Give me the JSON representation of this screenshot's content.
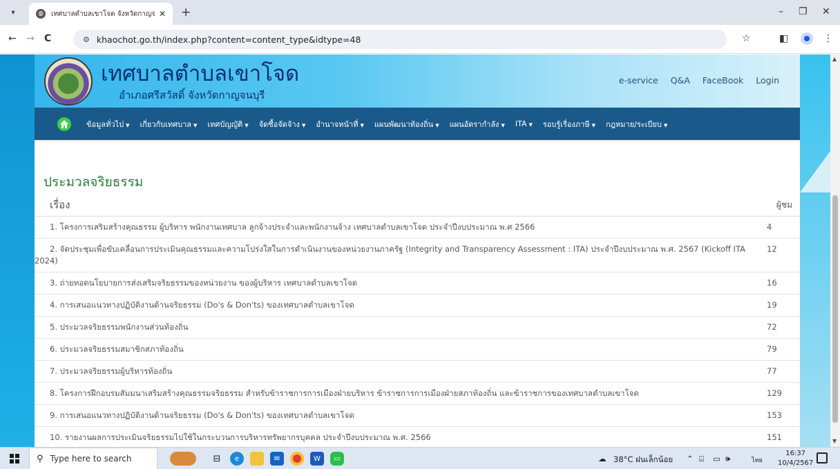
{
  "browser": {
    "tab_title": "เทศบาลตำบลเขาโจด จังหวัดกาญจนบุรี",
    "tab_close": "✕",
    "new_tab": "+",
    "url": "khaochot.go.th/index.php?content=content_type&idtype=48",
    "controls": {
      "minimize": "–",
      "maximize": "❐",
      "close": "✕",
      "back": "←",
      "forward": "→",
      "reload": "C",
      "star": "☆",
      "menu": "⋮"
    }
  },
  "site": {
    "title": "เทศบาลตำบลเขาโจด",
    "subtitle": "อำเภอศรีสวัสดิ์  จังหวัดกาญจนบุรี",
    "header_links": [
      "e-service",
      "Q&A",
      "FaceBook",
      "Login"
    ]
  },
  "nav": {
    "items": [
      "ข้อมูลทั่วไป",
      "เกี่ยวกับเทศบาล",
      "เทศบัญญัติ",
      "จัดซื้อจัดจ้าง",
      "อำนาจหน้าที่",
      "แผนพัฒนาท้องถิ่น",
      "แผนอัตรากำลัง",
      "ITA",
      "รอบรู้เรื่องภาษี",
      "กฎหมาย/ระเบียบ"
    ]
  },
  "section": {
    "title": "ประมวลจริยธรรม",
    "col_title": "เรื่อง",
    "col_views": "ผู้ชม"
  },
  "rows": [
    {
      "title": "1. โครงการเสริมสร้างคุณธรรม ผู้บริหาร พนักงานเทศบาล ลูกจ้างประจำและพนักงานจ้าง เทศบาลตำบลเขาโจด ประจำปีงบประมาณ พ.ศ 2566",
      "views": "4"
    },
    {
      "title": "2. จัดประชุมเพื่อขับเคลื่อนการประเมินคุณธรรมและความโปร่งใสในการดำเนินงานของหน่วยงานภาครัฐ (Integrity and Transparency Assessment : ITA) ประจำปีงบประมาณ พ.ศ. 2567 (Kickoff ITA 2024)",
      "views": "12"
    },
    {
      "title": "3. ถ่ายทอดนโยบายการส่งเสริมจริยธรรมของหน่วยงาน ของผู้บริหาร เทศบาลตำบลเขาโจด",
      "views": "16"
    },
    {
      "title": "4. การเสนอแนวทางปฏิบัติงานด้านจริยธรรม (Do's & Don'ts) ของเทศบาลตำบลเขาโจด",
      "views": "19"
    },
    {
      "title": "5. ประมวลจริยธรรมพนักงานส่วนท้องถิ่น",
      "views": "72"
    },
    {
      "title": "6. ประมวลจริยธรรมสมาชิกสภาท้องถิ่น",
      "views": "79"
    },
    {
      "title": "7. ประมวลจริยธรรมผู้บริหารท้องถิ่น",
      "views": "77"
    },
    {
      "title": "8. โครงการฝึกอบรมสัมมนาเสริมสร้างคุณธรรมจริยธรรม สำหรับข้าราชการการเมืองฝ่ายบริหาร ข้าราชการการเมืองฝ่ายสภาท้องถิ่น และข้าราชการของเทศบาลตำบลเขาโจด",
      "views": "129"
    },
    {
      "title": "9. การเสนอแนวทางปฏิบัติงานด้านจริยธรรม (Do's & Don'ts) ของเทศบาลตำบลเขาโจด",
      "views": "153"
    },
    {
      "title": "10. รายงานผลการประเมินจริยธรรมไปใช้ในกระบวนการบริหารทรัพยากรบุคคล ประจำปีงบประมาณ พ.ศ. 2566",
      "views": "151"
    }
  ],
  "taskbar": {
    "search_placeholder": "Type here to search",
    "weather": "38°C  ฝนเล็กน้อย",
    "lang": "ไทย",
    "time": "16:37",
    "date": "10/4/2567"
  }
}
